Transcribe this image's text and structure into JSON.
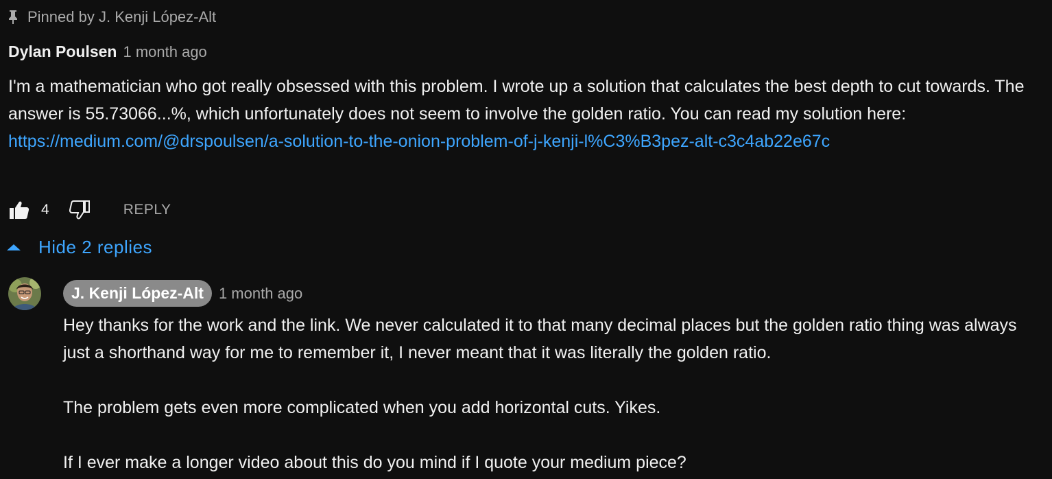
{
  "pinned": {
    "label": "Pinned by J. Kenji López-Alt",
    "icon": "pin-icon"
  },
  "comment": {
    "author": "Dylan Poulsen",
    "time": "1 month ago",
    "text": "I'm a mathematician who got really obsessed with this problem. I wrote up a solution that calculates the best depth to cut towards. The answer is 55.73066...%, which unfortunately does not seem to involve the golden ratio. You can read my solution here:",
    "link": "https://medium.com/@drspoulsen/a-solution-to-the-onion-problem-of-j-kenji-l%C3%B3pez-alt-c3c4ab22e67c",
    "likes": "4",
    "reply_label": "REPLY"
  },
  "replies_toggle": {
    "label": "Hide 2 replies"
  },
  "reply": {
    "author": "J. Kenji López-Alt",
    "time": "1 month ago",
    "paragraph_1": "Hey thanks for the work and the link. We never calculated it to that many decimal places but the golden ratio thing was always just a shorthand way for me to remember it, I never meant that it was literally the golden ratio.",
    "paragraph_2": "The problem gets even more complicated when you add horizontal cuts. Yikes.",
    "paragraph_3": "If I ever make a longer video about this do you mind if I quote your medium piece?"
  },
  "colors": {
    "background": "#0f0f0f",
    "text": "#f1f1f1",
    "muted": "#aaaaaa",
    "link": "#3ea6ff",
    "owner_chip": "#8a8a8a"
  }
}
